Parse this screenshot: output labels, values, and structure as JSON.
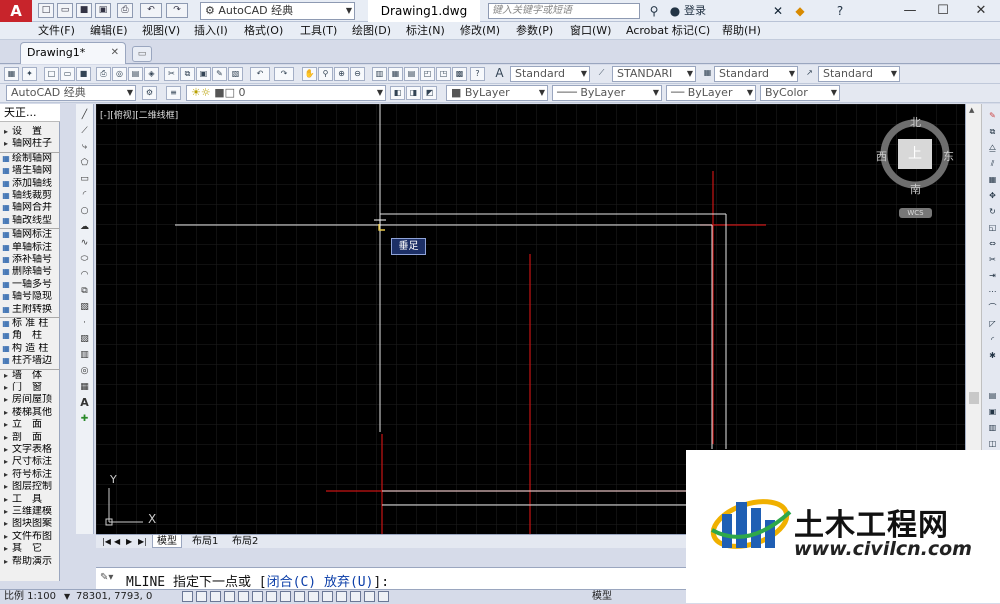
{
  "titlebar": {
    "logo": "A",
    "workspace": "AutoCAD 经典",
    "document_title": "Drawing1.dwg",
    "search_placeholder": "键入关键字或短语",
    "login": "登录"
  },
  "menu": [
    "文件(F)",
    "编辑(E)",
    "视图(V)",
    "插入(I)",
    "格式(O)",
    "工具(T)",
    "绘图(D)",
    "标注(N)",
    "修改(M)",
    "参数(P)",
    "窗口(W)",
    "Acrobat 标记(C)",
    "帮助(H)"
  ],
  "tabs": {
    "active": "Drawing1*"
  },
  "toolbar": {
    "text_style": "Standard",
    "dim_style": "STANDARI",
    "table_style": "Standard",
    "mleader_style": "Standard",
    "workspace2": "AutoCAD 经典",
    "layer": "0",
    "color": "ByLayer",
    "linetype": "ByLayer",
    "lineweight": "ByLayer",
    "plotstyle": "ByColor"
  },
  "leftpanel": {
    "title": "天正...",
    "items": [
      {
        "label": "设　置",
        "type": "section"
      },
      {
        "label": "轴网柱子",
        "type": "section"
      },
      {
        "label": "绘制轴网",
        "type": "item"
      },
      {
        "label": "墙生轴网",
        "type": "item"
      },
      {
        "label": "添加轴线",
        "type": "item"
      },
      {
        "label": "轴线裁剪",
        "type": "item"
      },
      {
        "label": "轴网合并",
        "type": "item"
      },
      {
        "label": "轴改线型",
        "type": "item"
      },
      {
        "label": "轴网标注",
        "type": "item"
      },
      {
        "label": "单轴标注",
        "type": "item"
      },
      {
        "label": "添补轴号",
        "type": "item"
      },
      {
        "label": "删除轴号",
        "type": "item"
      },
      {
        "label": "一轴多号",
        "type": "item"
      },
      {
        "label": "轴号隐现",
        "type": "item"
      },
      {
        "label": "主附转换",
        "type": "item"
      },
      {
        "label": "标 准 柱",
        "type": "item"
      },
      {
        "label": "角　柱",
        "type": "item"
      },
      {
        "label": "构 造 柱",
        "type": "item"
      },
      {
        "label": "柱齐墙边",
        "type": "item"
      },
      {
        "label": "墙　体",
        "type": "section"
      },
      {
        "label": "门　窗",
        "type": "section"
      },
      {
        "label": "房间屋顶",
        "type": "section"
      },
      {
        "label": "楼梯其他",
        "type": "section"
      },
      {
        "label": "立　面",
        "type": "section"
      },
      {
        "label": "剖　面",
        "type": "section"
      },
      {
        "label": "文字表格",
        "type": "section"
      },
      {
        "label": "尺寸标注",
        "type": "section"
      },
      {
        "label": "符号标注",
        "type": "section"
      },
      {
        "label": "图层控制",
        "type": "section"
      },
      {
        "label": "工　具",
        "type": "section"
      },
      {
        "label": "三维建模",
        "type": "section"
      },
      {
        "label": "图块图案",
        "type": "section"
      },
      {
        "label": "文件布图",
        "type": "section"
      },
      {
        "label": "其　它",
        "type": "section"
      },
      {
        "label": "帮助演示",
        "type": "section"
      }
    ]
  },
  "canvas": {
    "viewport_label": "[-][俯视][二维线框]",
    "tooltip": "垂足",
    "compass": {
      "north": "北",
      "south": "南",
      "east": "东",
      "west": "西",
      "top": "上",
      "wcs": "WCS"
    },
    "ucs": {
      "x": "X",
      "y": "Y"
    }
  },
  "layout_tabs": [
    "模型",
    "布局1",
    "布局2"
  ],
  "command": {
    "prefix": "MLINE 指定下一点或 [",
    "opt1": "闭合(C)",
    "mid": " ",
    "opt2": "放弃(U)",
    "suffix": "]:"
  },
  "status": {
    "scale": "比例 1:100",
    "coords": "78301, 7793, 0",
    "model": "模型"
  },
  "watermark": {
    "title": "土木工程网",
    "url": "www.civilcn.com"
  },
  "colors": {
    "canvas_bg": "#000000",
    "red_line": "#c81414",
    "white_line": "#e6e6e6",
    "grid": "#1c1c1c",
    "brand_blue": "#1f5fb4"
  }
}
